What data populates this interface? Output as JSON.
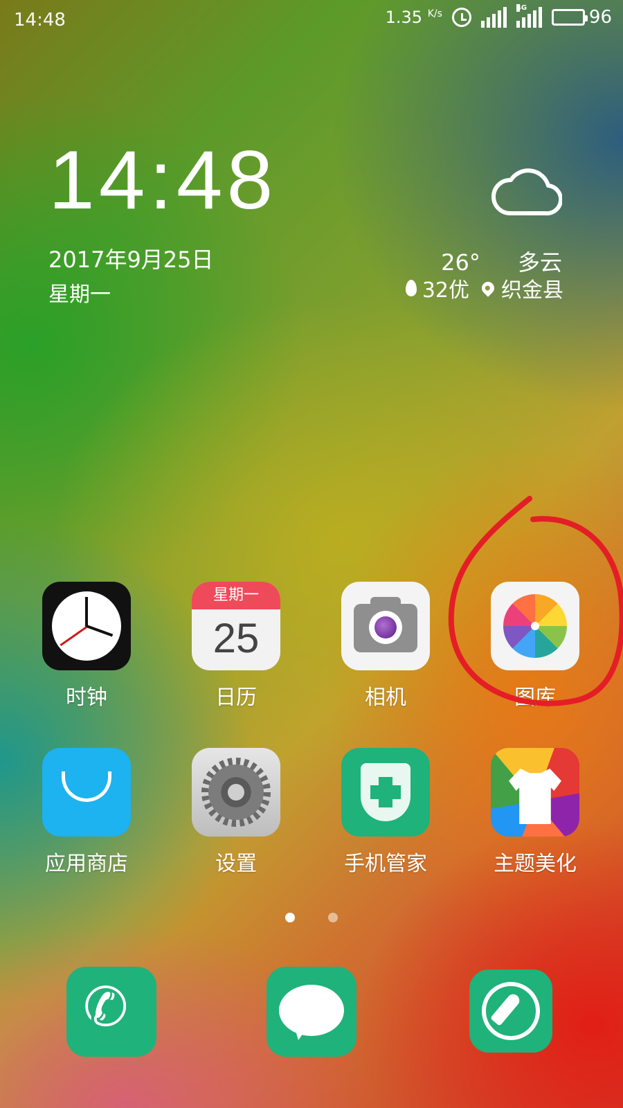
{
  "status_bar": {
    "time": "14:48",
    "net_speed": "1.35",
    "net_unit": "K/s",
    "network_type": "4G",
    "battery": "96"
  },
  "clock_widget": {
    "time": "14:48",
    "date": "2017年9月25日",
    "weekday": "星期一"
  },
  "weather": {
    "icon": "cloud-icon",
    "temperature": "26°",
    "condition": "多云",
    "air_quality": "32优",
    "location": "织金县"
  },
  "apps": [
    {
      "label": "时钟",
      "icon": "clock-icon"
    },
    {
      "label": "日历",
      "icon": "calendar-icon",
      "weekday": "星期一",
      "day": "25"
    },
    {
      "label": "相机",
      "icon": "camera-icon"
    },
    {
      "label": "图库",
      "icon": "gallery-icon"
    },
    {
      "label": "应用商店",
      "icon": "app-store-icon"
    },
    {
      "label": "设置",
      "icon": "settings-icon"
    },
    {
      "label": "手机管家",
      "icon": "phone-manager-icon"
    },
    {
      "label": "主题美化",
      "icon": "theme-icon"
    }
  ],
  "page_indicator": {
    "pages": 2,
    "current": 1
  },
  "dock": [
    {
      "icon": "phone-icon"
    },
    {
      "icon": "messages-icon"
    },
    {
      "icon": "browser-icon"
    }
  ],
  "colors": {
    "annotation": "#e41e26",
    "green_app": "#1fb27b",
    "store_blue": "#1db2f0",
    "calendar_red": "#ef4a5a"
  }
}
